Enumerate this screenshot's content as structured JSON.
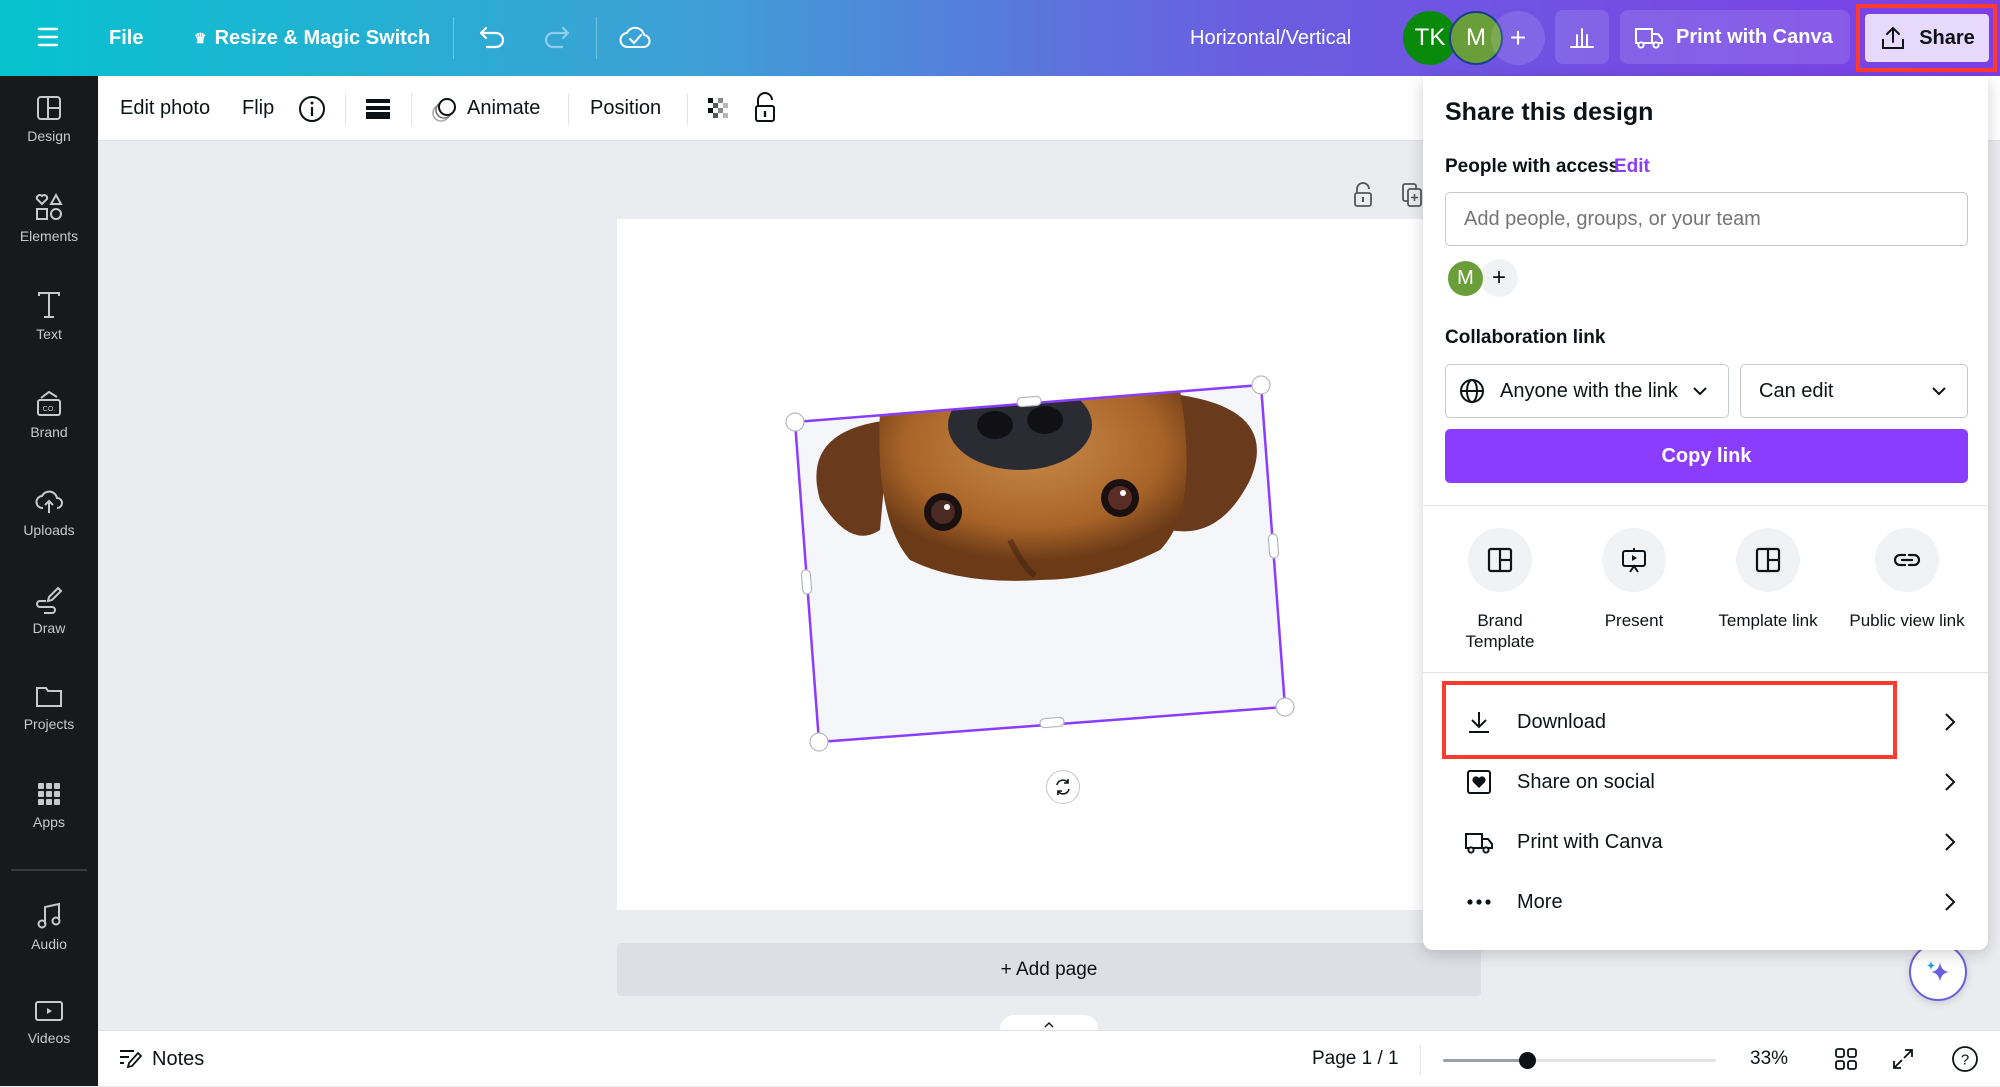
{
  "topbar": {
    "file_label": "File",
    "resize_label": "Resize & Magic Switch",
    "design_title": "Horizontal/Vertical",
    "avatars": [
      {
        "initials": "TK",
        "color": "#0a8a0a"
      },
      {
        "initials": "M",
        "color": "#6a9e3a"
      }
    ],
    "add_collaborator": "+",
    "print_label": "Print with Canva",
    "share_label": "Share",
    "accent_share_bg": "#e6d9fb",
    "highlight_color": "#ff3b30"
  },
  "sidebar": {
    "items": [
      {
        "label": "Design",
        "icon": "layout-icon"
      },
      {
        "label": "Elements",
        "icon": "shapes-icon"
      },
      {
        "label": "Text",
        "icon": "text-icon"
      },
      {
        "label": "Brand",
        "icon": "brand-icon"
      },
      {
        "label": "Uploads",
        "icon": "cloud-upload-icon"
      },
      {
        "label": "Draw",
        "icon": "draw-icon"
      },
      {
        "label": "Projects",
        "icon": "folder-icon"
      },
      {
        "label": "Apps",
        "icon": "apps-grid-icon"
      },
      {
        "label": "Audio",
        "icon": "music-note-icon"
      },
      {
        "label": "Videos",
        "icon": "video-icon"
      }
    ]
  },
  "toolbar": {
    "edit_photo": "Edit photo",
    "flip": "Flip",
    "animate": "Animate",
    "position": "Position"
  },
  "canvas": {
    "add_page": "+ Add page",
    "image_description": "Upside-down dog face photo, rotated and selected",
    "selection_color": "#8b3dff"
  },
  "bottombar": {
    "notes": "Notes",
    "page_indicator": "Page 1 / 1",
    "zoom_percent": "33%",
    "zoom_slider_fraction": 0.33
  },
  "share_panel": {
    "title": "Share this design",
    "people_label": "People with access",
    "edit_link": "Edit",
    "people_input_placeholder": "Add people, groups, or your team",
    "member_initial": "M",
    "add_member": "+",
    "collab_label": "Collaboration link",
    "access_select": "Anyone with the link",
    "permission_select": "Can edit",
    "copy_link": "Copy link",
    "quick_actions": [
      {
        "label": "Brand Template",
        "icon": "brand-template-icon"
      },
      {
        "label": "Present",
        "icon": "present-icon"
      },
      {
        "label": "Template link",
        "icon": "template-link-icon"
      },
      {
        "label": "Public view link",
        "icon": "link-icon"
      }
    ],
    "menu": [
      {
        "label": "Download",
        "icon": "download-icon"
      },
      {
        "label": "Share on social",
        "icon": "heart-icon"
      },
      {
        "label": "Print with Canva",
        "icon": "truck-icon"
      },
      {
        "label": "More",
        "icon": "more-icon"
      }
    ]
  }
}
